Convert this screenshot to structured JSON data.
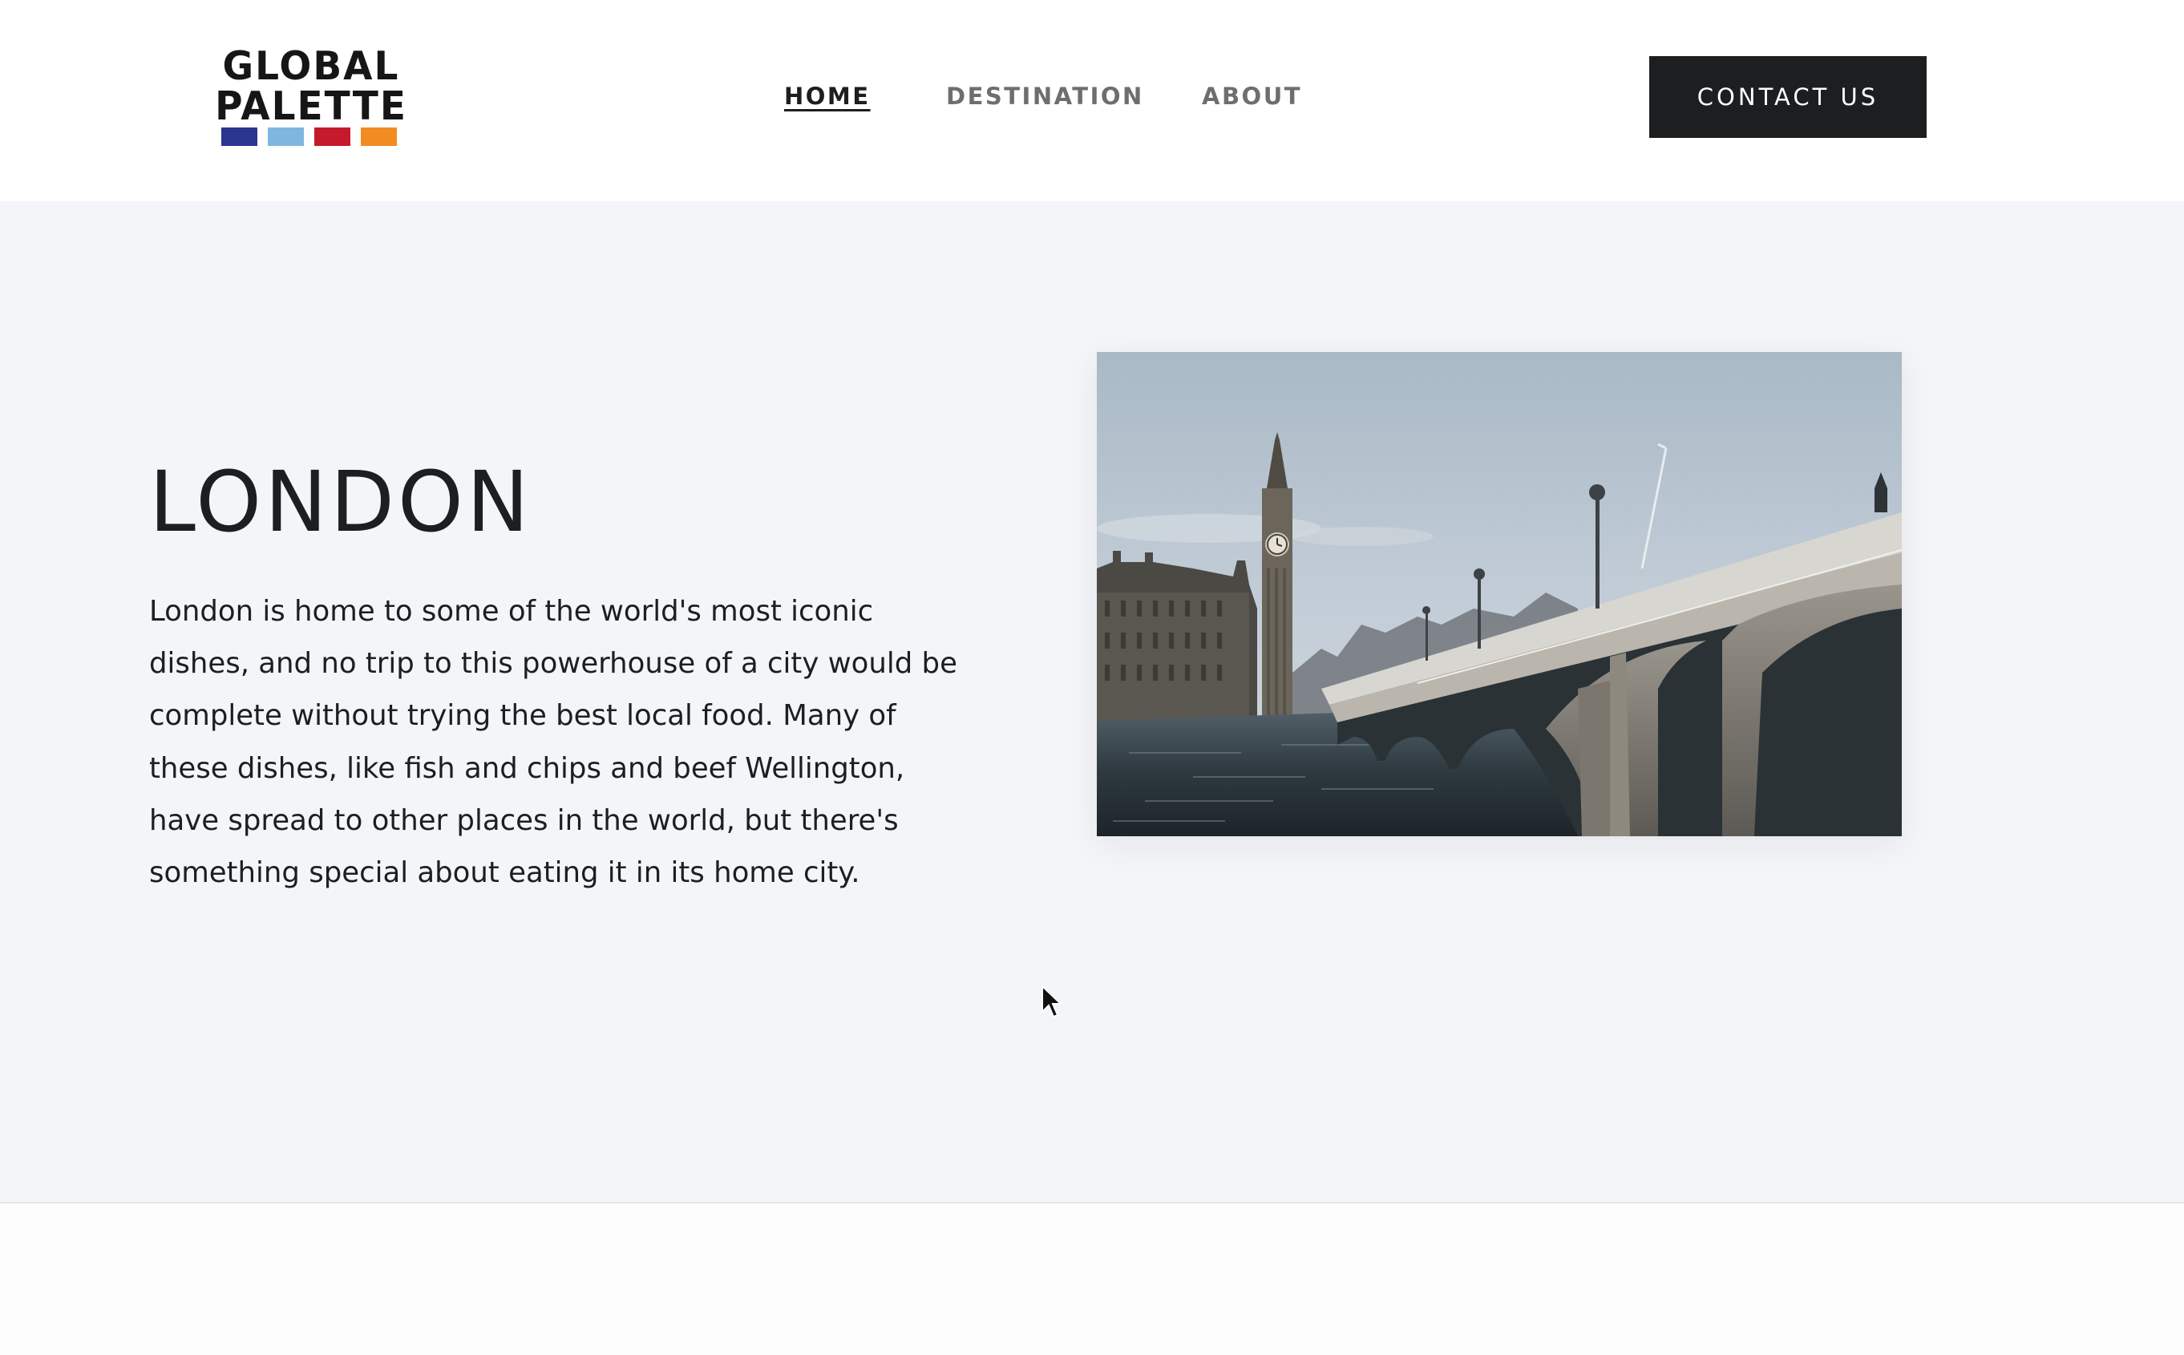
{
  "brand": {
    "line1": "GLOBAL",
    "line2": "PALETTE",
    "swatches": [
      "#2a3590",
      "#7db7e0",
      "#c41a2c",
      "#f28c22"
    ]
  },
  "nav": {
    "items": [
      {
        "label": "HOME",
        "active": true
      },
      {
        "label": "DESTINATION",
        "active": false
      },
      {
        "label": "ABOUT",
        "active": false
      }
    ],
    "contact_label": "CONTACT US"
  },
  "hero": {
    "title": "LONDON",
    "description": "London is home to some of the world's most iconic dishes, and no trip to this powerhouse of a city would be complete without trying the best local food. Many of these dishes, like fish and chips and beef Wellington, have spread to other places in the world, but there's something special about eating it in its home city.",
    "image_subject": "Big Ben and Westminster Bridge over the River Thames"
  },
  "colors": {
    "page_bg": "#f4f5f8",
    "header_bg": "#ffffff",
    "text": "#1d1e20",
    "nav_muted": "#6e6e72",
    "button_bg": "#1d1e20",
    "button_text": "#ffffff"
  },
  "icons": {
    "cursor": "mouse-pointer-icon"
  }
}
